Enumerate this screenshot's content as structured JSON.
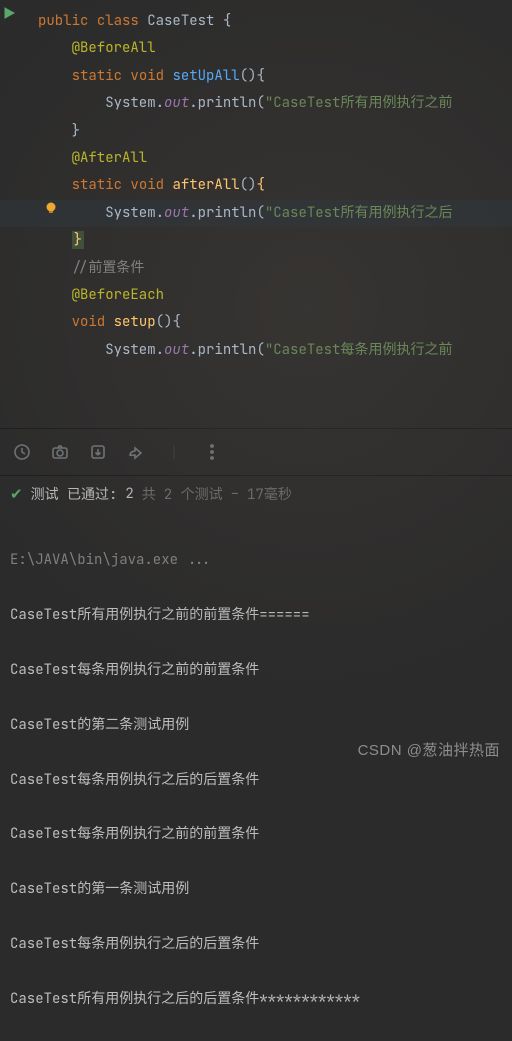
{
  "code": {
    "l1": {
      "public": "public",
      "class": "class",
      "name": "CaseTest",
      "ob": "{"
    },
    "l2": {
      "annot": "@BeforeAll"
    },
    "l3": {
      "static": "static",
      "void": "void",
      "name": "setUpAll",
      "parens": "()",
      "ob": "{"
    },
    "l4": {
      "sys": "System.",
      "out": "out",
      "dot": ".",
      "println": "println",
      "lp": "(",
      "str": "\"CaseTest所有用例执行之前",
      "rp": ")"
    },
    "l5": {
      "cb": "}"
    },
    "l6": {
      "annot": "@AfterAll"
    },
    "l7": {
      "static": "static",
      "void": "void",
      "name": "afterAll",
      "parens": "()",
      "ob": "{"
    },
    "l8": {
      "sys": "System.",
      "out": "out",
      "dot": ".",
      "println": "println",
      "lp": "(",
      "str": "\"CaseTest所有用例执行之后",
      "rp": ")"
    },
    "l9": {
      "cb": "}"
    },
    "l10": {
      "comment": "//前置条件"
    },
    "l11": {
      "annot": "@BeforeEach"
    },
    "l12": {
      "void": "void",
      "name": "setup",
      "parens": "()",
      "ob": "{"
    },
    "l13": {
      "sys": "System.",
      "out": "out",
      "dot": ".",
      "println": "println",
      "lp": "(",
      "str": "\"CaseTest每条用例执行之前"
    }
  },
  "status": {
    "label": "测试 已通过:",
    "passed": "2",
    "total_prefix": "共",
    "total": " 2 个测试",
    "sep": " – ",
    "time": "17毫秒"
  },
  "console": {
    "cmd": "E:\\JAVA\\bin\\java.exe ...",
    "r1": "CaseTest所有用例执行之前的前置条件======",
    "r2": "CaseTest每条用例执行之前的前置条件",
    "r3": "CaseTest的第二条测试用例",
    "r4": "CaseTest每条用例执行之后的后置条件",
    "r5": "CaseTest每条用例执行之前的前置条件",
    "r6": "CaseTest的第一条测试用例",
    "r7": "CaseTest每条用例执行之后的后置条件",
    "r8": "CaseTest所有用例执行之后的后置条件************"
  },
  "watermark": "CSDN @葱油拌热面",
  "icons": {
    "run": "run-gutter-icon",
    "bulb": "intention-bulb-icon",
    "history": "history-icon",
    "camera": "camera-icon",
    "import": "import-icon",
    "export": "export-icon",
    "more": "more-icon"
  }
}
